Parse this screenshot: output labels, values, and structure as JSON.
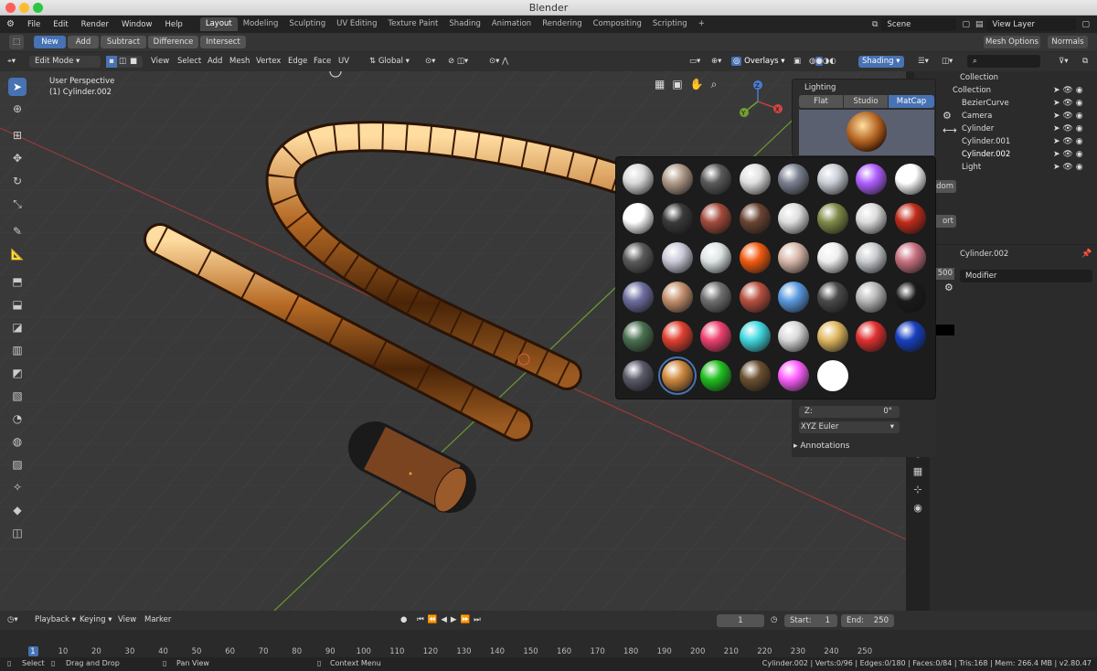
{
  "window_title": "Blender",
  "menu": [
    "File",
    "Edit",
    "Render",
    "Window",
    "Help"
  ],
  "workspaces": [
    "Layout",
    "Modeling",
    "Sculpting",
    "UV Editing",
    "Texture Paint",
    "Shading",
    "Animation",
    "Rendering",
    "Compositing",
    "Scripting",
    "+"
  ],
  "scene": "Scene",
  "view_layer": "View Layer",
  "toolheader": {
    "new": "New",
    "add": "Add",
    "subtract": "Subtract",
    "difference": "Difference",
    "intersect": "Intersect",
    "mesh_options": "Mesh Options",
    "normals": "Normals"
  },
  "viewport_header": {
    "mode": "Edit Mode",
    "view": "View",
    "select": "Select",
    "add": "Add",
    "mesh": "Mesh",
    "vertex": "Vertex",
    "edge": "Edge",
    "face": "Face",
    "uv": "UV",
    "orientation": "Global",
    "overlays": "Overlays",
    "shading": "Shading"
  },
  "viewport_info": {
    "perspective": "User Perspective",
    "object": "(1) Cylinder.002"
  },
  "gizmo": {
    "x": "X",
    "y": "Y",
    "z": "Z"
  },
  "shading_popover": {
    "title": "Lighting",
    "options": [
      "Flat",
      "Studio",
      "MatCap"
    ],
    "active": "MatCap"
  },
  "side_fragments": {
    "random": "dom",
    "export": "ort",
    "value_1500": "500",
    "rotation_z_label": "Z:",
    "rotation_z_value": "0°",
    "rotation_mode": "XYZ Euler",
    "annotations": "Annotations"
  },
  "matcap_colors": [
    [
      "#d9d9d9",
      "#b09a88",
      "#5a5a5a",
      "#e0e0e0",
      "#7a8090",
      "#c9ced6",
      "#b060ff",
      "#ffffff"
    ],
    [
      "#ffffff",
      "#3a3a3a",
      "#a34a3c",
      "#6a4432",
      "#dedede",
      "#7f8a48",
      "#dcdcdc",
      "#c02b1a"
    ],
    [
      "#5a5a5a",
      "#c9c9d8",
      "#dde4e4",
      "#f25a10",
      "#d8b8aa",
      "#eeeeee",
      "#c8cbcf",
      "#c77080"
    ],
    [
      "#6e6ea0",
      "#c4906e",
      "#707070",
      "#b85040",
      "#5a9ae0",
      "#4a4a4a",
      "#b8b8b8",
      "#1a1a1a"
    ],
    [
      "#4a7050",
      "#e04030",
      "#ee4070",
      "#40d8e0",
      "#d8d8d8",
      "#e0b860",
      "#e03030",
      "#1840c0"
    ],
    [
      "#5a5a6a",
      "#d08a40",
      "#20c020",
      "#6a5030",
      "#ff60ff",
      "#ffffff"
    ]
  ],
  "outliner": {
    "collection": "Collection",
    "items": [
      "BezierCurve",
      "Camera",
      "Cylinder",
      "Cylinder.001",
      "Cylinder.002",
      "Light"
    ],
    "prop_object": "Cylinder.002",
    "modifier": "Modifier"
  },
  "timeline": {
    "playback": "Playback",
    "keying": "Keying",
    "view": "View",
    "marker": "Marker",
    "current": "1",
    "start_label": "Start:",
    "start": "1",
    "end_label": "End:",
    "end": "250",
    "ticks": [
      "1",
      "10",
      "20",
      "30",
      "40",
      "50",
      "60",
      "70",
      "80",
      "90",
      "100",
      "110",
      "120",
      "130",
      "140",
      "150",
      "160",
      "170",
      "180",
      "190",
      "200",
      "210",
      "220",
      "230",
      "240",
      "250"
    ]
  },
  "statusbar": {
    "select": "Select",
    "drag": "Drag and Drop",
    "pan": "Pan View",
    "context": "Context Menu",
    "stats": "Cylinder.002 | Verts:0/96 | Edges:0/180 | Faces:0/84 | Tris:168 | Mem: 266.4 MB | v2.80.47"
  }
}
